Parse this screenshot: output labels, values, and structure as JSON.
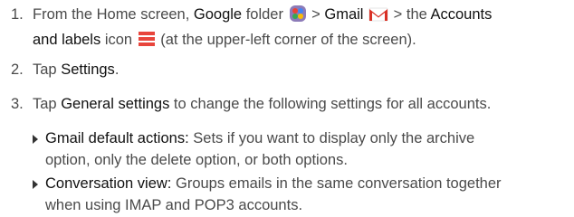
{
  "steps": [
    {
      "number": "1.",
      "parts": {
        "p1": "From the Home screen, ",
        "k1": "Google",
        "p2": " folder ",
        "p3": " > ",
        "k2": "Gmail",
        "p4": " > the ",
        "k3": "Accounts",
        "k4": "and labels",
        "p5": " icon ",
        "p6": " (at the upper-left corner of the screen)."
      }
    },
    {
      "number": "2.",
      "parts": {
        "p1": "Tap ",
        "k1": "Settings",
        "p2": "."
      }
    },
    {
      "number": "3.",
      "parts": {
        "p1": "Tap ",
        "k1": "General settings",
        "p2": " to change the following settings for all accounts."
      }
    }
  ],
  "bullets": [
    {
      "term": "Gmail default actions:",
      "line1": " Sets if you want to display only the archive",
      "line2": "option, only the delete option, or both options."
    },
    {
      "term": "Conversation view:",
      "line1": " Groups emails in the same conversation together",
      "line2": "when using IMAP and POP3 accounts."
    }
  ],
  "icons": {
    "google_folder": "google-folder-icon",
    "gmail": "gmail-icon",
    "accounts_labels": "menu-icon"
  },
  "colors": {
    "text": "#4a4a4a",
    "keyword": "#111111",
    "menu_icon": "#e8453c",
    "gmail_red": "#d93025"
  }
}
